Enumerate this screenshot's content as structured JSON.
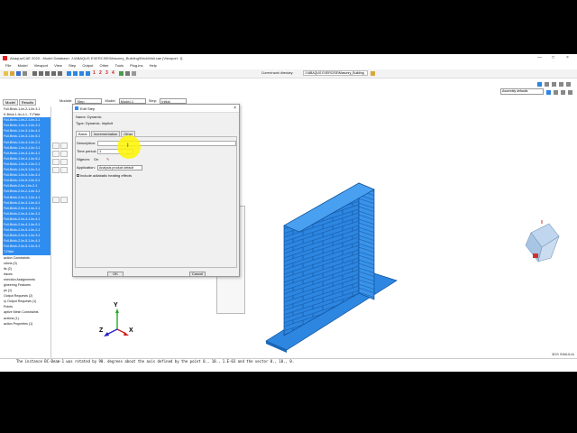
{
  "window": {
    "title": "Abaqus/CAE 2020 - Model Database: J:\\ABAQUS EXERCISE\\Masonry_Building\\BrickWall.cae [Viewport: 1]",
    "controls": [
      "—",
      "□",
      "×"
    ]
  },
  "menu": [
    "File",
    "Model",
    "Viewport",
    "View",
    "Step",
    "Output",
    "Other",
    "Tools",
    "Plug-ins",
    "Help"
  ],
  "toolbar": {
    "workdir_label": "Current work directory:",
    "workdir_value": "J:\\ABAQUS EXERCISE\\Masonry_Building",
    "step_numbers": [
      "1",
      "2",
      "3",
      "4"
    ]
  },
  "tree_tabs": [
    "Model",
    "Results"
  ],
  "context": {
    "module_label": "Module:",
    "module_value": "Step",
    "model_label": "Model:",
    "model_value": "Model-1",
    "step_label": "Step:",
    "step_value": "Initial",
    "assembly_select": "Assembly defaults"
  },
  "tree": {
    "head_items": [
      "Full-Brick-1-lin-2-1-lin-3-1",
      "K-Brick-1-lin-4-1.. F-Plate"
    ],
    "selected_items": [
      "Full-Brick-1-lin-2-1-lin-3-1",
      "Full-Brick-1-lin-3-1-lin-3-1",
      "Full-Brick-1-lin-3-1-lin-4-1",
      "Full-Brick-1-lin-3-1-lin-5-1",
      "Full-Brick-1-lin-4-1-lin-2-1",
      "Full-Brick-1-lin-4-1-lin-3-1",
      "Full-Brick-1-lin-4-1-lin-4-1",
      "Full-Brick-1-lin-4-1-lin-5-1",
      "Full-Brick-1-lin-5-1-lin-2-1",
      "Full-Brick-1-lin-5-1-lin-3-1",
      "Full-Brick-1-lin-5-1-lin-4-1",
      "Full-Brick-1-lin-5-1-lin-5-1",
      "Full-Brick-2-lin-1-lin-2-1",
      "Full-Brick-2-lin-2-1-lin-3-1",
      "Full-Brick-2-lin-3-1-lin-4-1",
      "Full-Brick-2-lin-3-1-lin-5-1",
      "Full-Brick-2-lin-4-1-lin-2-1",
      "Full-Brick-2-lin-4-1-lin-3-1",
      "Full-Brick-2-lin-4-1-lin-4-1",
      "Full-Brick-2-lin-4-1-lin-5-1",
      "Full-Brick-2-lin-5-1-lin-2-1",
      "Full-Brick-2-lin-5-1-lin-3-1",
      "Full-Brick-2-lin-5-1-lin-4-1",
      "Full-Brick-2-lin-5-1-lin-5-1",
      "T-Plate"
    ],
    "tail_items": [
      "action Constraints",
      "ctions (0)",
      "its (2)",
      "rfaces",
      "nnection Assignments",
      "gineering Features",
      "ps (1)",
      "Output Requests (2)",
      "ry Output Requests (1)",
      "Points",
      "aptive Mesh Constraints",
      "actions (1)",
      "action Properties (1)"
    ]
  },
  "dialog": {
    "title": "Edit Step",
    "name_label": "Name:",
    "name_value": "Dynamic",
    "type_label": "Type:",
    "type_value": "Dynamic, Implicit",
    "tabs": [
      "Basic",
      "Incrementation",
      "Other"
    ],
    "description_label": "Description:",
    "description_value": "",
    "time_label": "Time period:",
    "time_value": "1",
    "nlgeom_label": "Nlgeom:",
    "nlgeom_value": "On",
    "application_label": "Application:",
    "application_value": "Analysis product default",
    "adiabatic_label": "Include adiabatic heating effects",
    "ok_label": "OK",
    "cancel_label": "Cancel"
  },
  "viewport": {
    "triad_labels": [
      "Y",
      "Z",
      "X"
    ],
    "brick_color": "#2d86e0",
    "brick_edge": "#0d4f99"
  },
  "message": "The instance BC-Beam-1 was rotated by 90. degrees about the axis defined by the point 0., 10., 1.E-03 and the vector 0., 10., 0.",
  "brand": "3DS SIMULIA",
  "colors": {
    "selection": "#2f8df0",
    "highlight": "#fff200"
  }
}
